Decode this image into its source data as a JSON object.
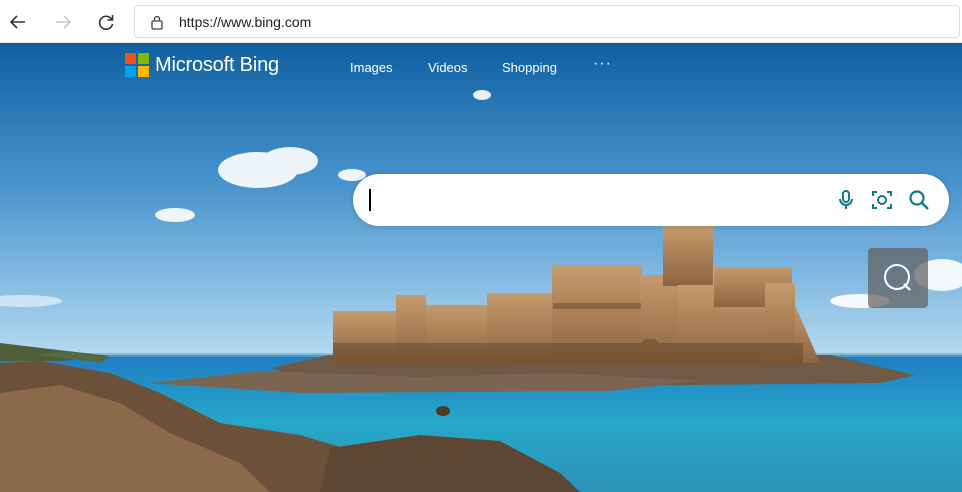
{
  "browser": {
    "url": "https://www.bing.com",
    "icons": {
      "back": "back-arrow-icon",
      "forward": "forward-arrow-icon",
      "reload": "reload-icon",
      "lock": "lock-icon"
    }
  },
  "bing": {
    "logo_text": "Microsoft Bing",
    "nav": [
      "Images",
      "Videos",
      "Shopping"
    ],
    "more_label": "···",
    "brand_colors": [
      "#f25022",
      "#7fba00",
      "#00a4ef",
      "#ffb900"
    ],
    "accent": "#0e7a8a",
    "search": {
      "value": "",
      "icons": [
        "microphone-icon",
        "visual-search-icon",
        "search-icon"
      ]
    },
    "side_button_icon": "chat-search-icon"
  }
}
